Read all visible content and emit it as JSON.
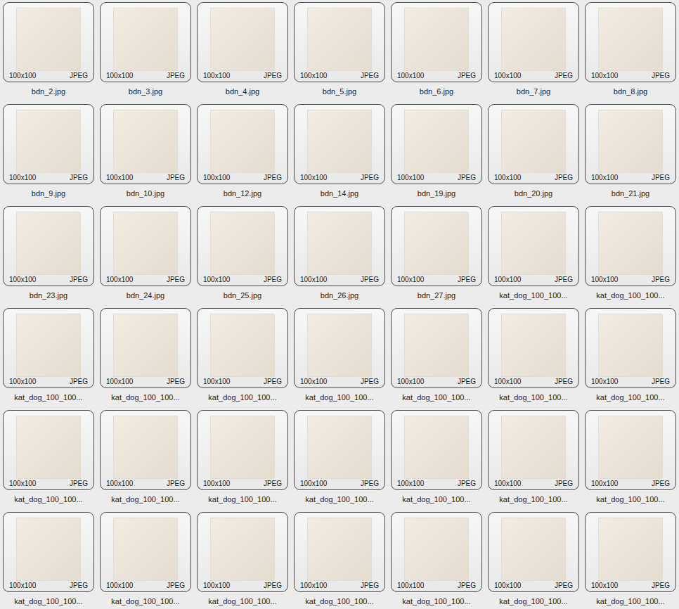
{
  "files": [
    {
      "name": "bdn_2.jpg",
      "size": "100x100",
      "format": "JPEG"
    },
    {
      "name": "bdn_3.jpg",
      "size": "100x100",
      "format": "JPEG"
    },
    {
      "name": "bdn_4.jpg",
      "size": "100x100",
      "format": "JPEG"
    },
    {
      "name": "bdn_5.jpg",
      "size": "100x100",
      "format": "JPEG"
    },
    {
      "name": "bdn_6.jpg",
      "size": "100x100",
      "format": "JPEG"
    },
    {
      "name": "bdn_7.jpg",
      "size": "100x100",
      "format": "JPEG"
    },
    {
      "name": "bdn_8.jpg",
      "size": "100x100",
      "format": "JPEG"
    },
    {
      "name": "bdn_9.jpg",
      "size": "100x100",
      "format": "JPEG"
    },
    {
      "name": "bdn_10.jpg",
      "size": "100x100",
      "format": "JPEG"
    },
    {
      "name": "bdn_12.jpg",
      "size": "100x100",
      "format": "JPEG"
    },
    {
      "name": "bdn_14.jpg",
      "size": "100x100",
      "format": "JPEG"
    },
    {
      "name": "bdn_19.jpg",
      "size": "100x100",
      "format": "JPEG"
    },
    {
      "name": "bdn_20.jpg",
      "size": "100x100",
      "format": "JPEG"
    },
    {
      "name": "bdn_21.jpg",
      "size": "100x100",
      "format": "JPEG"
    },
    {
      "name": "bdn_23.jpg",
      "size": "100x100",
      "format": "JPEG"
    },
    {
      "name": "bdn_24.jpg",
      "size": "100x100",
      "format": "JPEG"
    },
    {
      "name": "bdn_25.jpg",
      "size": "100x100",
      "format": "JPEG"
    },
    {
      "name": "bdn_26.jpg",
      "size": "100x100",
      "format": "JPEG"
    },
    {
      "name": "bdn_27.jpg",
      "size": "100x100",
      "format": "JPEG"
    },
    {
      "name": "kat_dog_100_100...",
      "size": "100x100",
      "format": "JPEG"
    },
    {
      "name": "kat_dog_100_100...",
      "size": "100x100",
      "format": "JPEG"
    },
    {
      "name": "kat_dog_100_100...",
      "size": "100x100",
      "format": "JPEG"
    },
    {
      "name": "kat_dog_100_100...",
      "size": "100x100",
      "format": "JPEG"
    },
    {
      "name": "kat_dog_100_100...",
      "size": "100x100",
      "format": "JPEG"
    },
    {
      "name": "kat_dog_100_100...",
      "size": "100x100",
      "format": "JPEG"
    },
    {
      "name": "kat_dog_100_100...",
      "size": "100x100",
      "format": "JPEG"
    },
    {
      "name": "kat_dog_100_100...",
      "size": "100x100",
      "format": "JPEG"
    },
    {
      "name": "kat_dog_100_100...",
      "size": "100x100",
      "format": "JPEG"
    },
    {
      "name": "kat_dog_100_100...",
      "size": "100x100",
      "format": "JPEG"
    },
    {
      "name": "kat_dog_100_100...",
      "size": "100x100",
      "format": "JPEG"
    },
    {
      "name": "kat_dog_100_100...",
      "size": "100x100",
      "format": "JPEG"
    },
    {
      "name": "kat_dog_100_100...",
      "size": "100x100",
      "format": "JPEG"
    },
    {
      "name": "kat_dog_100_100...",
      "size": "100x100",
      "format": "JPEG"
    },
    {
      "name": "kat_dog_100_100...",
      "size": "100x100",
      "format": "JPEG"
    },
    {
      "name": "kat_dog_100_100...",
      "size": "100x100",
      "format": "JPEG"
    },
    {
      "name": "kat_dog_100_100...",
      "size": "100x100",
      "format": "JPEG"
    },
    {
      "name": "kat_dog_100_100...",
      "size": "100x100",
      "format": "JPEG"
    },
    {
      "name": "kat_dog_100_100...",
      "size": "100x100",
      "format": "JPEG"
    },
    {
      "name": "kat_dog_100_100...",
      "size": "100x100",
      "format": "JPEG"
    },
    {
      "name": "kat_dog_100_100...",
      "size": "100x100",
      "format": "JPEG"
    },
    {
      "name": "kat_dog_100_100...",
      "size": "100x100",
      "format": "JPEG"
    },
    {
      "name": "kat_dog_100_100...",
      "size": "100x100",
      "format": "JPEG"
    }
  ]
}
